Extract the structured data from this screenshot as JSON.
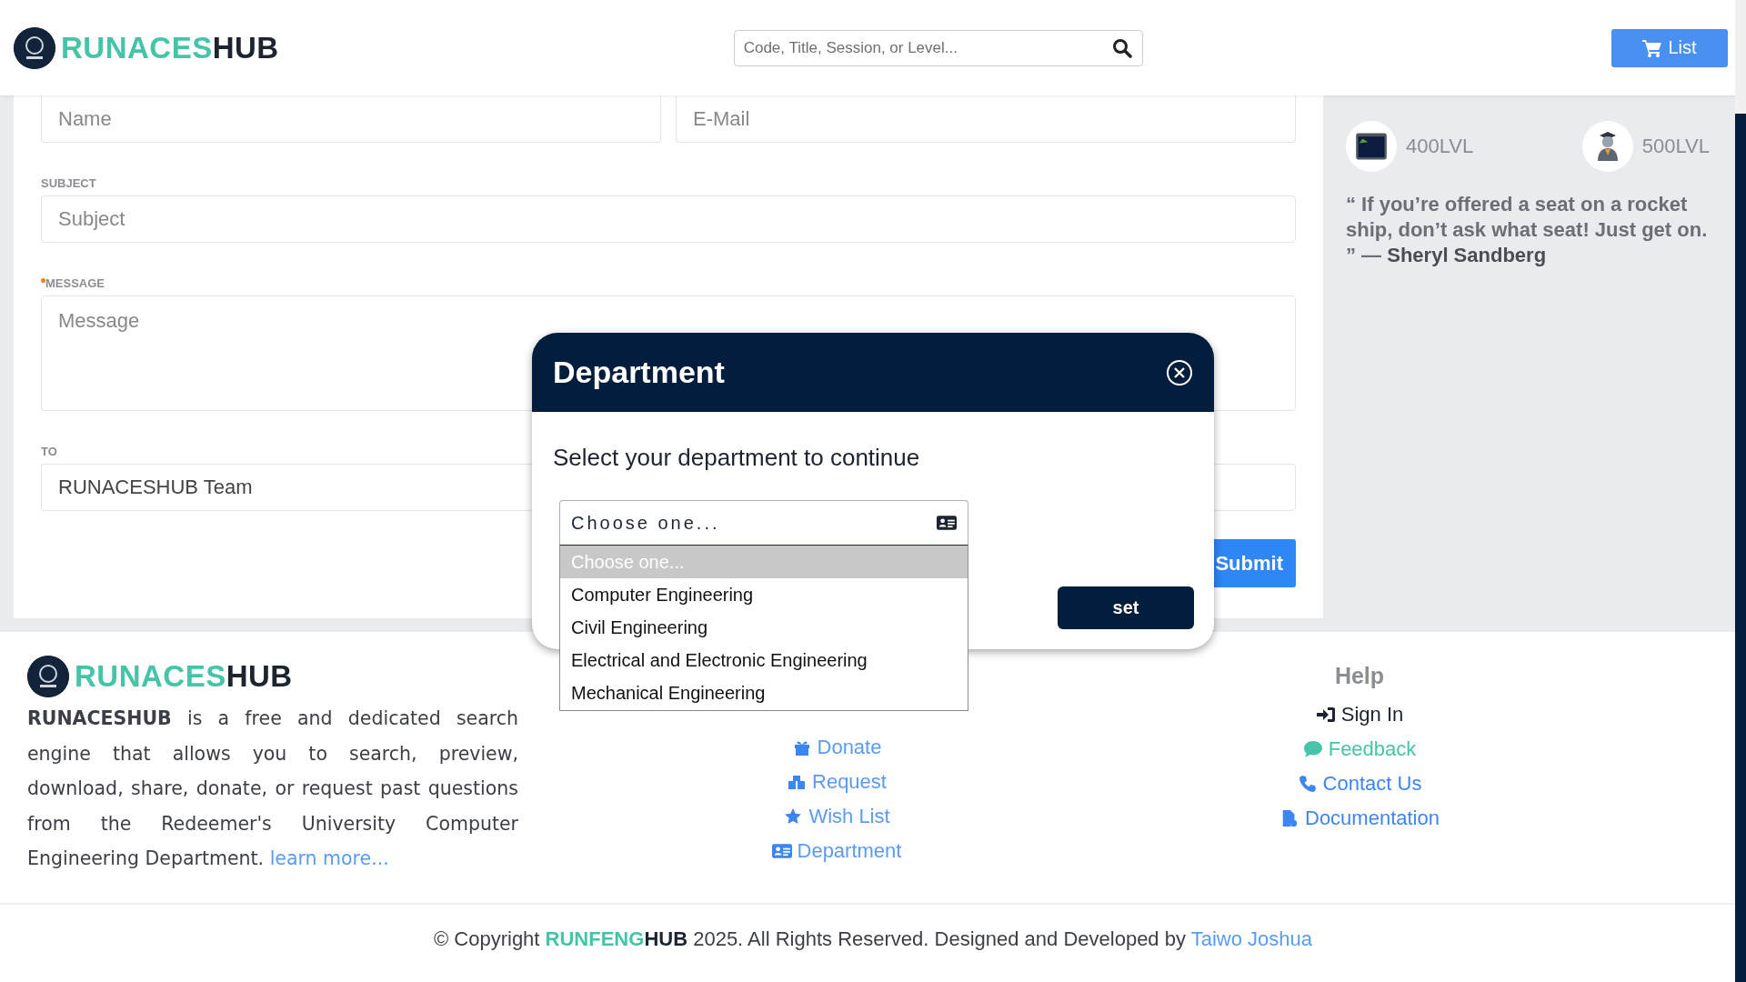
{
  "header": {
    "logo": {
      "part_1": "RUNACES",
      "part_2": "HUB"
    },
    "search": {
      "placeholder": "Code, Title, Session, or Level..."
    },
    "list_button": "List"
  },
  "contact_form": {
    "name": {
      "placeholder": "Name"
    },
    "email": {
      "placeholder": "E-Mail"
    },
    "subject": {
      "label": "SUBJECT",
      "placeholder": "Subject"
    },
    "message": {
      "label": "MESSAGE",
      "required": true,
      "placeholder": "Message"
    },
    "to": {
      "label": "TO",
      "value": "RUNACESHUB Team"
    },
    "submit_button": "Submit"
  },
  "sidebar": {
    "levels": [
      {
        "label": "400LVL",
        "kind": "monitor"
      },
      {
        "label": "500LVL",
        "kind": "graduate"
      }
    ],
    "quote": "“ If you’re offered a seat on a rocket ship, don’t ask what seat! Just get on. ” — **Sheryl Sandberg**"
  },
  "footer": {
    "logo": {
      "part_1": "RUNACES",
      "part_2": "HUB"
    },
    "about": "**RUNACESHUB** is a free and dedicated search engine that allows you to search, preview, download, share, donate, or request past questions from the Redeemer's University Computer Engineering Department.",
    "about_link": "learn more...",
    "links": [
      {
        "label": "Donate",
        "kind": "gift"
      },
      {
        "label": "Request",
        "kind": "request"
      },
      {
        "label": "Wish List",
        "kind": "star"
      },
      {
        "label": "Department",
        "kind": "id-card"
      }
    ],
    "help": {
      "title": "Help",
      "links": [
        {
          "label": "Sign In",
          "kind": "sign-in",
          "color": "#1c2430"
        },
        {
          "label": "Feedback",
          "kind": "chat",
          "color": "#45c4a8"
        },
        {
          "label": "Contact Us",
          "kind": "phone",
          "color": "#3d86f0"
        },
        {
          "label": "Documentation",
          "kind": "file",
          "color": "#3d86f0"
        }
      ]
    },
    "copyright": {
      "prefix": "© Copyright",
      "brand_1": "RUNFENG",
      "brand_2": "HUB",
      "suffix": "2025. All Rights Reserved. Designed and Developed by",
      "author": "Taiwo Joshua"
    }
  },
  "modal": {
    "title": "Department",
    "prompt": "Select your department to continue",
    "select": {
      "value": "Choose one...",
      "expanded": true
    },
    "options": [
      {
        "label": "Choose one...",
        "selected": true
      },
      {
        "label": "Computer Engineering",
        "selected": false
      },
      {
        "label": "Civil Engineering",
        "selected": false
      },
      {
        "label": "Electrical and Electronic Engineering",
        "selected": false
      },
      {
        "label": "Mechanical Engineering",
        "selected": false
      }
    ],
    "button": "set"
  }
}
